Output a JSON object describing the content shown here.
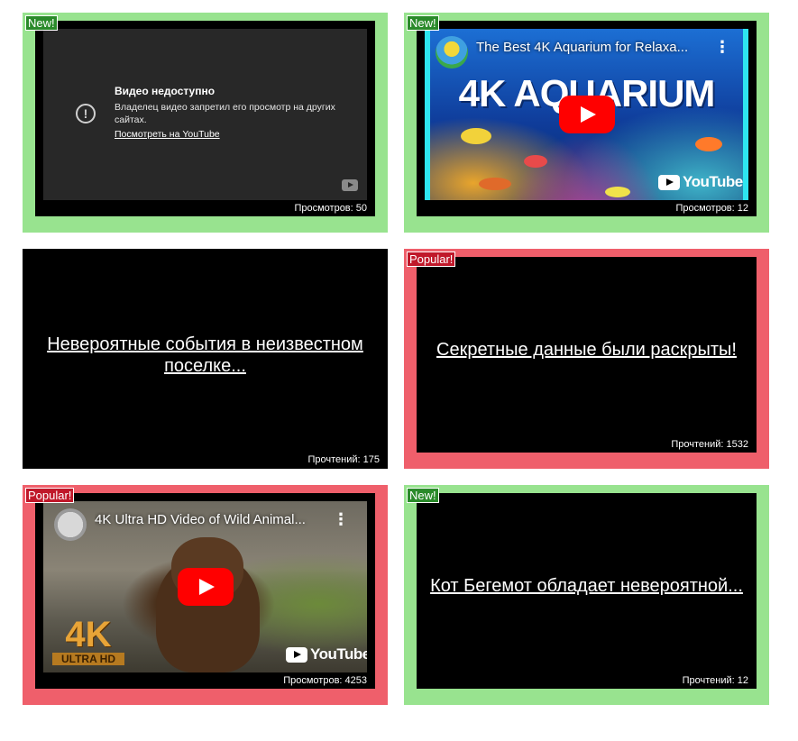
{
  "cards": [
    {
      "badge": "New!",
      "video": {
        "unavailable_title": "Видео недоступно",
        "unavailable_desc": "Владелец видео запретил его просмотр на других сайтах.",
        "watch_link": "Посмотреть на YouTube"
      },
      "meta": "Просмотров: 50"
    },
    {
      "badge": "New!",
      "video": {
        "title": "The Best 4K Aquarium for Relaxa...",
        "heading": "4K AQUARIUM",
        "logo": "YouTube"
      },
      "meta": "Просмотров: 12"
    },
    {
      "badge": "",
      "story": "Невероятные события в неизвестном поселке...",
      "meta": "Прочтений: 175"
    },
    {
      "badge": "Popular!",
      "story": "Секретные данные были раскрыты!",
      "meta": "Прочтений: 1532"
    },
    {
      "badge": "Popular!",
      "video": {
        "title": "4K Ultra HD Video of Wild Animal...",
        "k4": "4K",
        "ultra": "ULTRA HD",
        "logo": "YouTube"
      },
      "meta": "Просмотров: 4253"
    },
    {
      "badge": "New!",
      "story": "Кот Бегемот обладает невероятной...",
      "meta": "Прочтений: 12"
    }
  ],
  "colors": {
    "new": "#98e38f",
    "popular": "#ef5f6b",
    "youtube_red": "#ff0000"
  }
}
